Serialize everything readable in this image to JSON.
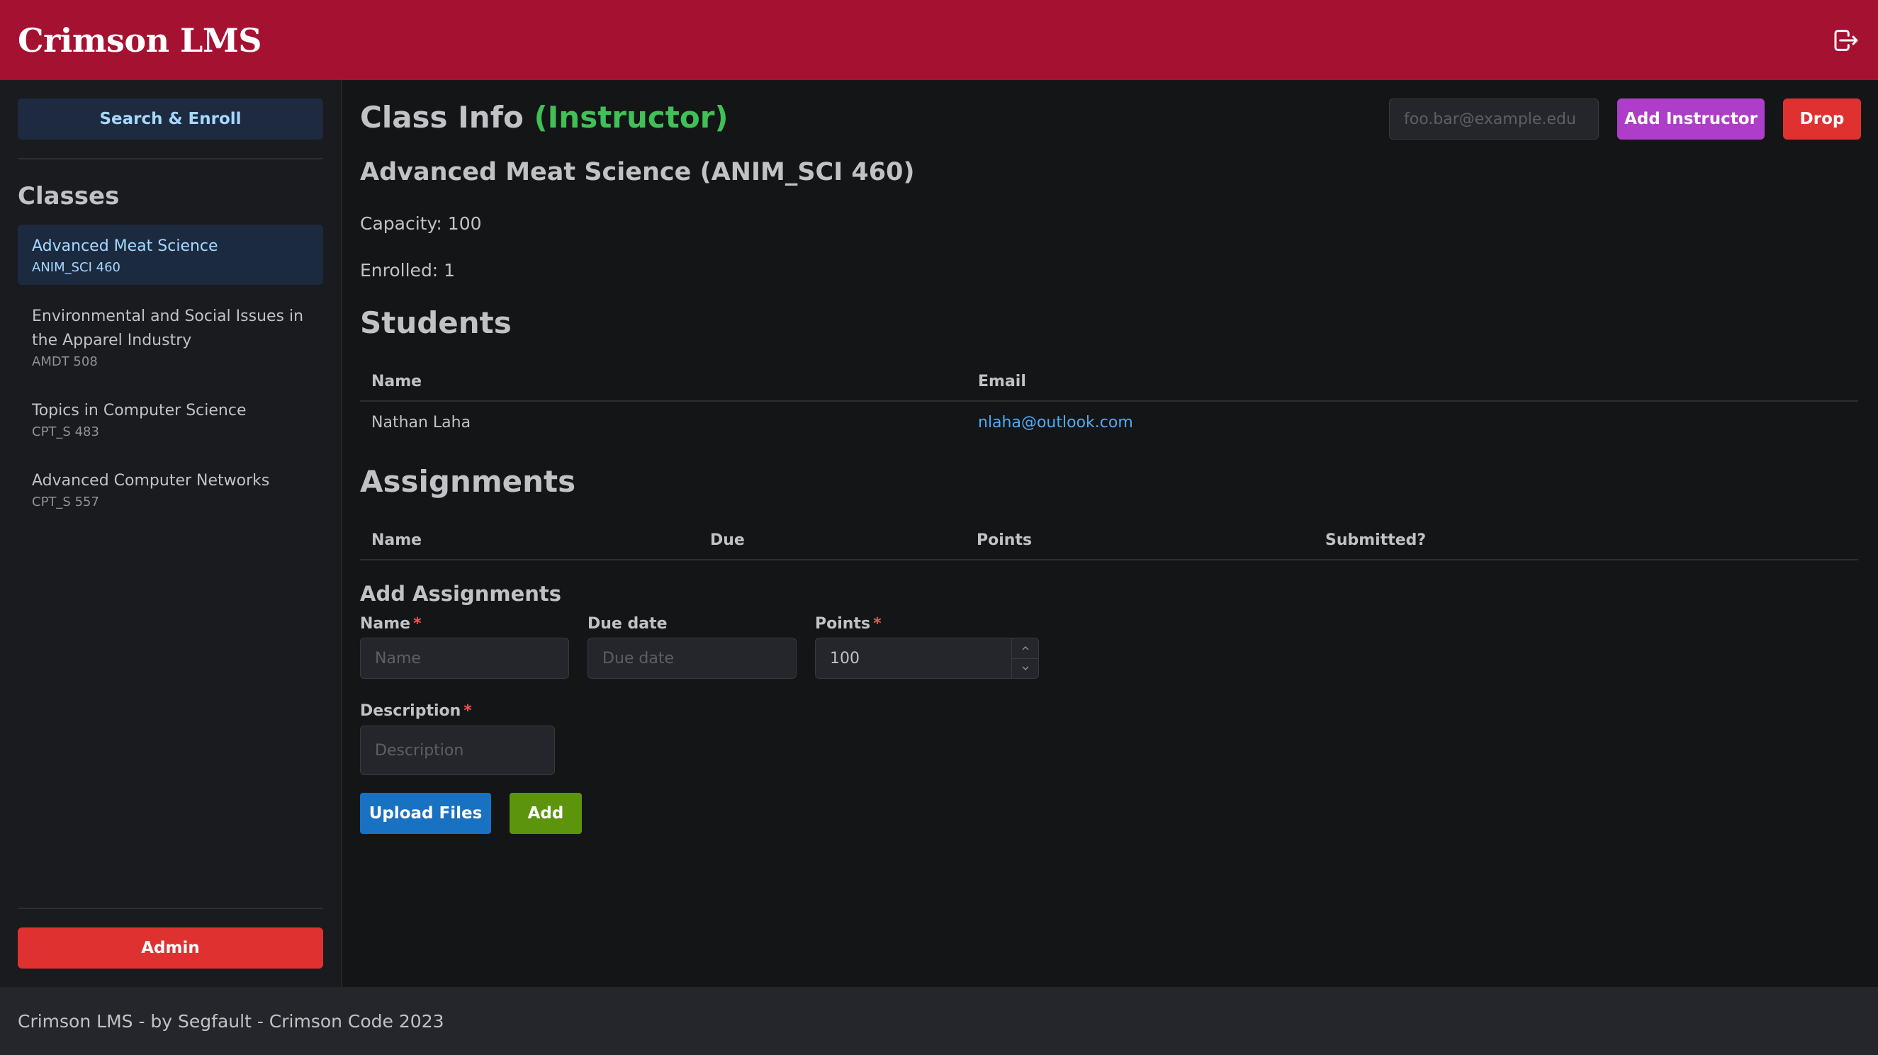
{
  "app": {
    "title": "Crimson LMS",
    "logout_icon": "logout-icon"
  },
  "sidebar": {
    "search_button": "Search & Enroll",
    "classes_heading": "Classes",
    "classes": [
      {
        "name": "Advanced Meat Science",
        "code": "ANIM_SCI 460",
        "active": true
      },
      {
        "name": "Environmental and Social Issues in the Apparel Industry",
        "code": "AMDT 508",
        "active": false
      },
      {
        "name": "Topics in Computer Science",
        "code": "CPT_S 483",
        "active": false
      },
      {
        "name": "Advanced Computer Networks",
        "code": "CPT_S 557",
        "active": false
      }
    ],
    "admin_button": "Admin"
  },
  "main": {
    "title": "Class Info",
    "role": "(Instructor)",
    "instructor_email_placeholder": "foo.bar@example.edu",
    "add_instructor_button": "Add Instructor",
    "drop_button": "Drop",
    "course_title": "Advanced Meat Science (ANIM_SCI 460)",
    "capacity": "Capacity: 100",
    "enrolled": "Enrolled: 1",
    "students": {
      "heading": "Students",
      "columns": [
        "Name",
        "Email"
      ],
      "rows": [
        {
          "name": "Nathan Laha",
          "email": "nlaha@outlook.com"
        }
      ]
    },
    "assignments": {
      "heading": "Assignments",
      "columns": [
        "Name",
        "Due",
        "Points",
        "Submitted?"
      ]
    },
    "add_assignments": {
      "heading": "Add Assignments",
      "name_label": "Name",
      "name_placeholder": "Name",
      "due_label": "Due date",
      "due_placeholder": "Due date",
      "points_label": "Points",
      "points_value": "100",
      "description_label": "Description",
      "description_placeholder": "Description",
      "required_marker": "*",
      "upload_button": "Upload Files",
      "add_button": "Add"
    }
  },
  "footer": {
    "text": "Crimson LMS - by Segfault - Crimson Code 2023"
  },
  "colors": {
    "header": "#a51131",
    "background": "#141517",
    "accent_blue": "#4dabf7",
    "role_green": "#40c057",
    "danger_red": "#e03131",
    "purple": "#ae3ec9"
  }
}
